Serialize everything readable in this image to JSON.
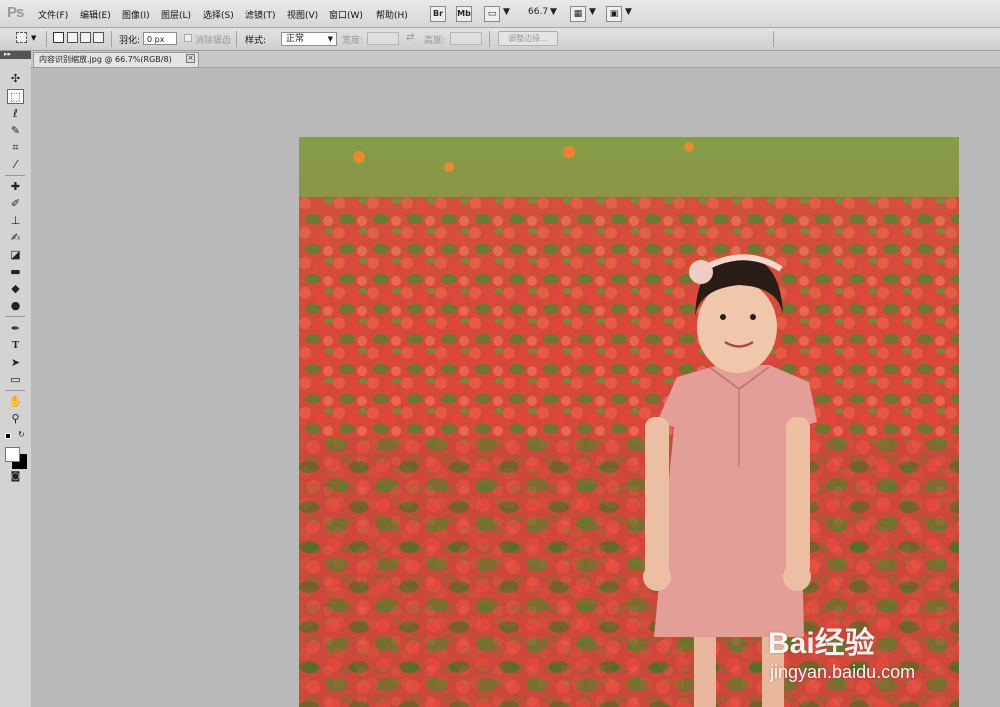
{
  "app": {
    "logo_text": "Ps"
  },
  "menubar": {
    "items": [
      "文件(F)",
      "编辑(E)",
      "图像(I)",
      "图层(L)",
      "选择(S)",
      "滤镜(T)",
      "视图(V)",
      "窗口(W)",
      "帮助(H)"
    ],
    "bridge_label": "Br",
    "minibridge_label": "Mb",
    "zoom_value": "66.7"
  },
  "options": {
    "feather_label": "羽化:",
    "feather_value": "0 px",
    "antialias_label": "消除锯齿",
    "style_label": "样式:",
    "style_value": "正常",
    "width_label": "宽度:",
    "height_label": "高度:",
    "refine_edge_label": "调整边缘..."
  },
  "document": {
    "tab_title": "内容识别缩放.jpg @ 66.7%(RGB/8)",
    "close_glyph": "×"
  },
  "watermark": {
    "logo_text": "Bai经验",
    "url_text": "jingyan.baidu.com"
  },
  "tools": [
    "move-tool",
    "marquee-tool",
    "lasso-tool",
    "quick-selection-tool",
    "crop-tool",
    "eyedropper-tool",
    "spot-healing-tool",
    "brush-tool",
    "clone-stamp-tool",
    "history-brush-tool",
    "eraser-tool",
    "gradient-tool",
    "blur-tool",
    "dodge-tool",
    "pen-tool",
    "type-tool",
    "path-selection-tool",
    "rectangle-tool",
    "hand-tool",
    "zoom-tool",
    "quick-mask-tool"
  ],
  "colors": {
    "foreground": "#ffffff",
    "background": "#000000"
  }
}
